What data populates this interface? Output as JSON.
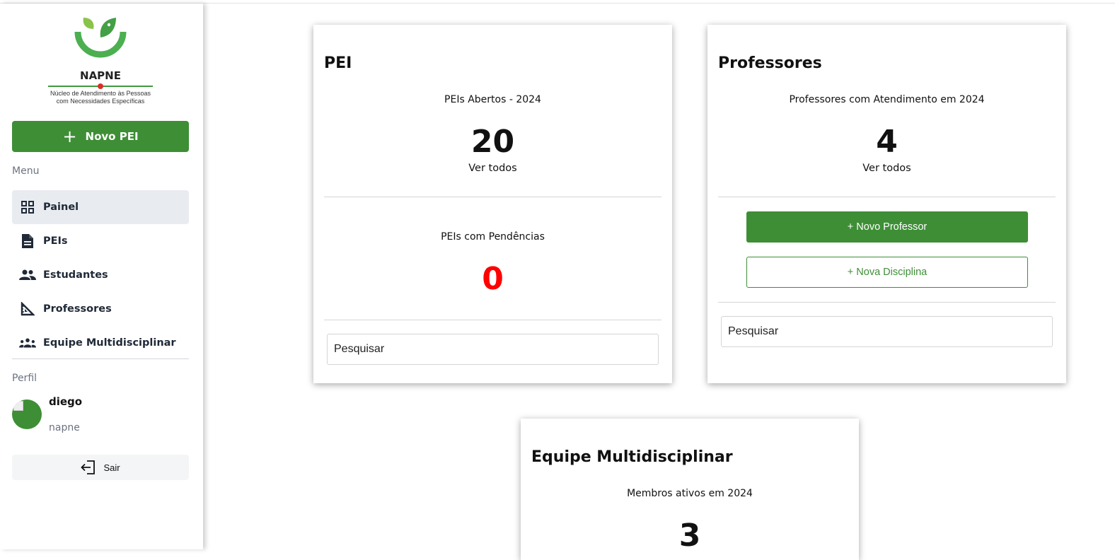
{
  "brand": {
    "name": "NAPNE",
    "subtitle_line1": "Núcleo de Atendimento às Pessoas",
    "subtitle_line2": "com Necessidades Específicas",
    "primary_color": "#3e8e36",
    "accent_color": "#d9312a"
  },
  "sidebar": {
    "new_pei_plus": "+",
    "new_pei_label": "Novo PEI",
    "menu_heading": "Menu",
    "items": [
      {
        "label": "Painel",
        "icon": "dashboard-icon",
        "active": true
      },
      {
        "label": "PEIs",
        "icon": "document-icon",
        "active": false
      },
      {
        "label": "Estudantes",
        "icon": "people-icon",
        "active": false
      },
      {
        "label": "Professores",
        "icon": "ruler-square-icon",
        "active": false
      },
      {
        "label": "Equipe Multidisciplinar",
        "icon": "groups-icon",
        "active": false
      }
    ],
    "profile_heading": "Perfil",
    "user": {
      "name": "diego",
      "role": "napne"
    },
    "logout_label": "Sair"
  },
  "cards": {
    "pei": {
      "title": "PEI",
      "open_label": "PEIs Abertos - 2024",
      "open_count": "20",
      "see_all": "Ver todos",
      "pending_label": "PEIs com Pendências",
      "pending_count": "0",
      "pending_color": "#ff0000",
      "search_placeholder": "Pesquisar"
    },
    "professores": {
      "title": "Professores",
      "stat_label": "Professores com Atendimento em 2024",
      "stat_count": "4",
      "see_all": "Ver todos",
      "new_teacher": "+ Novo Professor",
      "new_subject": "+ Nova Disciplina",
      "search_placeholder": "Pesquisar"
    },
    "equipe": {
      "title": "Equipe Multidisciplinar",
      "stat_label": "Membros ativos em 2024",
      "stat_count": "3"
    }
  }
}
